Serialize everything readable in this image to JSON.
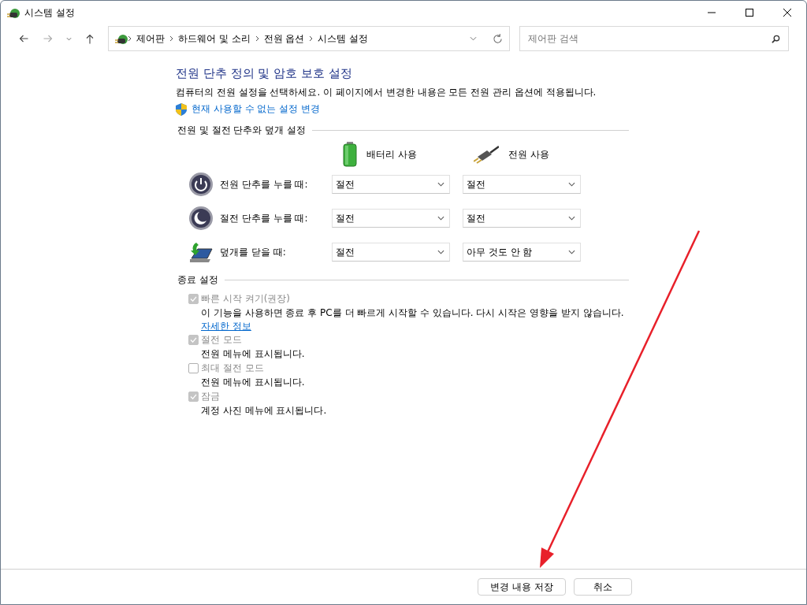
{
  "window": {
    "title": "시스템 설정"
  },
  "nav": {
    "breadcrumb": [
      "제어판",
      "하드웨어 및 소리",
      "전원 옵션",
      "시스템 설정"
    ],
    "search": {
      "placeholder": "제어판 검색"
    }
  },
  "page": {
    "heading": "전원 단추 정의 및 암호 보호 설정",
    "description": "컴퓨터의 전원 설정을 선택하세요. 이 페이지에서 변경한 내용은 모든 전원 관리 옵션에 적용됩니다.",
    "admin_link": "현재 사용할 수 없는 설정 변경"
  },
  "power_section": {
    "title": "전원 및 절전 단추와 덮개 설정",
    "columns": [
      {
        "kind": "battery",
        "label": "배터리 사용"
      },
      {
        "kind": "plug",
        "label": "전원 사용"
      }
    ],
    "rows": [
      {
        "kind": "power",
        "label": "전원 단추를 누를 때:",
        "values": [
          "절전",
          "절전"
        ]
      },
      {
        "kind": "sleep",
        "label": "절전 단추를 누를 때:",
        "values": [
          "절전",
          "절전"
        ]
      },
      {
        "kind": "lid",
        "label": "덮개를 닫을 때:",
        "values": [
          "절전",
          "아무 것도 안 함"
        ]
      }
    ]
  },
  "shutdown_section": {
    "title": "종료 설정",
    "options": [
      {
        "label": "빠른 시작 켜기(권장)",
        "checked": true,
        "disabled": true,
        "description": "이 기능을 사용하면 종료 후 PC를 더 빠르게 시작할 수 있습니다. 다시 시작은 영향을 받지 않습니다.",
        "link": "자세한 정보"
      },
      {
        "label": "절전 모드",
        "checked": true,
        "disabled": true,
        "description": "전원 메뉴에 표시됩니다."
      },
      {
        "label": "최대 절전 모드",
        "checked": false,
        "disabled": true,
        "description": "전원 메뉴에 표시됩니다."
      },
      {
        "label": "잠금",
        "checked": true,
        "disabled": true,
        "description": "계정 사진 메뉴에 표시됩니다."
      }
    ]
  },
  "buttons": [
    {
      "label": "변경 내용 저장"
    },
    {
      "label": "취소"
    }
  ]
}
